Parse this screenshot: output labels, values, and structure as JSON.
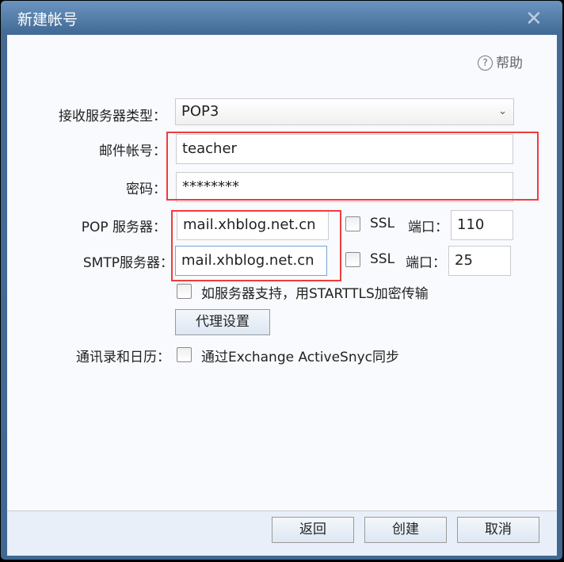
{
  "window": {
    "title": "新建帐号"
  },
  "help": {
    "label": "帮助"
  },
  "form": {
    "server_type": {
      "label": "接收服务器类型：",
      "value": "POP3"
    },
    "account": {
      "label": "邮件帐号：",
      "value": "teacher"
    },
    "password": {
      "label": "密码：",
      "value": "********"
    },
    "pop": {
      "label": "POP 服务器：",
      "value": "mail.xhblog.net.cn",
      "ssl_label": "SSL",
      "port_label": "端口：",
      "port": "110"
    },
    "smtp": {
      "label": "SMTP服务器：",
      "value": "mail.xhblog.net.cn",
      "ssl_label": "SSL",
      "port_label": "端口：",
      "port": "25"
    },
    "starttls_label": "如服务器支持，用STARTTLS加密传输",
    "proxy_button": "代理设置",
    "sync": {
      "label": "通讯录和日历：",
      "checkbox_label": "通过Exchange ActiveSnyc同步"
    }
  },
  "footer": {
    "back": "返回",
    "create": "创建",
    "cancel": "取消"
  },
  "colors": {
    "frame": "#436b96",
    "highlight": "#f03c3c"
  }
}
